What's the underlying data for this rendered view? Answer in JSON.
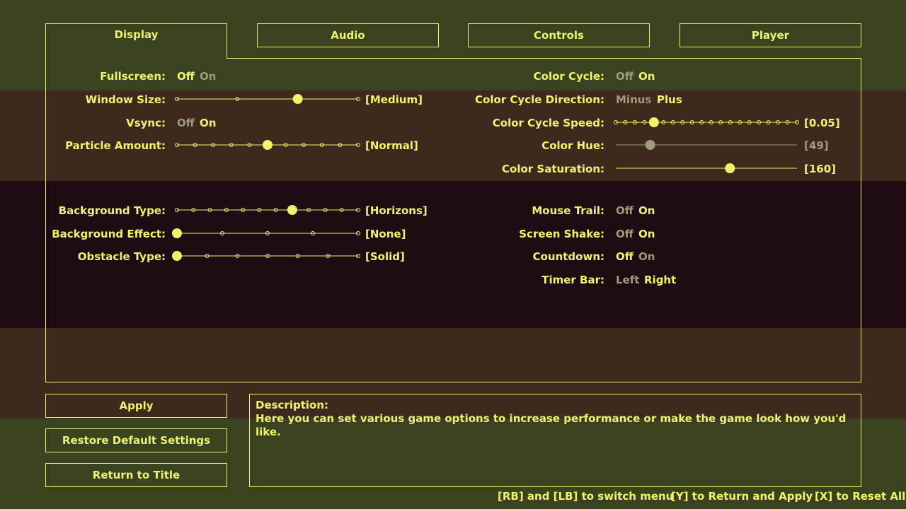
{
  "tabs": [
    {
      "label": "Display",
      "active": true
    },
    {
      "label": "Audio",
      "active": false
    },
    {
      "label": "Controls",
      "active": false
    },
    {
      "label": "Player",
      "active": false
    }
  ],
  "colors": {
    "accent": "#eef56a",
    "dim": "#9c9d78",
    "band_top": "#3a4220",
    "band_mid": "#3d2a1c",
    "band_dark": "#1e0c12"
  },
  "left": {
    "fullscreen": {
      "label": "Fullscreen:",
      "off": "Off",
      "on": "On",
      "selected": "Off"
    },
    "window_size": {
      "label": "Window Size:",
      "value": "[Medium]",
      "steps": 4,
      "index": 2
    },
    "vsync": {
      "label": "Vsync:",
      "off": "Off",
      "on": "On",
      "selected": "On"
    },
    "particle_amount": {
      "label": "Particle Amount:",
      "value": "[Normal]",
      "steps": 11,
      "index": 5
    },
    "background_type": {
      "label": "Background Type:",
      "value": "[Horizons]",
      "steps": 12,
      "index": 7
    },
    "background_effect": {
      "label": "Background Effect:",
      "value": "[None]",
      "steps": 5,
      "index": 0
    },
    "obstacle_type": {
      "label": "Obstacle Type:",
      "value": "[Solid]",
      "steps": 7,
      "index": 0
    }
  },
  "right": {
    "color_cycle": {
      "label": "Color Cycle:",
      "off": "Off",
      "on": "On",
      "selected": "On"
    },
    "color_cycle_direction": {
      "label": "Color Cycle Direction:",
      "off": "Minus",
      "on": "Plus",
      "selected": "Plus"
    },
    "color_cycle_speed": {
      "label": "Color Cycle Speed:",
      "value": "[0.05]",
      "steps": 20,
      "index": 4
    },
    "color_hue": {
      "label": "Color Hue:",
      "value": "[49]",
      "fraction": 0.19,
      "disabled": true
    },
    "color_saturation": {
      "label": "Color Saturation:",
      "value": "[160]",
      "fraction": 0.63
    },
    "mouse_trail": {
      "label": "Mouse Trail:",
      "off": "Off",
      "on": "On",
      "selected": "On"
    },
    "screen_shake": {
      "label": "Screen Shake:",
      "off": "Off",
      "on": "On",
      "selected": "On"
    },
    "countdown": {
      "label": "Countdown:",
      "off": "Off",
      "on": "On",
      "selected": "Off"
    },
    "timer_bar": {
      "label": "Timer Bar:",
      "off": "Left",
      "on": "Right",
      "selected": "Right"
    }
  },
  "buttons": {
    "apply": "Apply",
    "restore": "Restore Default Settings",
    "return": "Return to Title"
  },
  "description": {
    "title": "Description:",
    "text": "Here you can set various game options to increase performance or make the game look how you'd like."
  },
  "hints": {
    "switch": "[RB] and [LB] to switch menu",
    "return": "[Y] to Return and Apply",
    "reset": "[X] to Reset All."
  }
}
